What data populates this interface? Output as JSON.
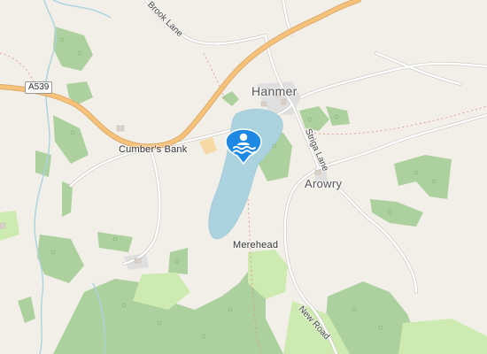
{
  "map": {
    "places": {
      "hanmer": "Hanmer",
      "arowry": "Arowry",
      "cumbers_bank": "Cumber's Bank",
      "merehead": "Merehead"
    },
    "roads": {
      "brook_lane": "Brook Lane",
      "striga_lane": "Striga Lane",
      "new_road": "New Road",
      "a539": "A539"
    },
    "marker": {
      "icon": "swimming-icon",
      "color": "#1e88e5"
    },
    "colors": {
      "land": "#f2efe9",
      "woodland": "#add19e",
      "grass": "#cdebb0",
      "water": "#aad3df",
      "major_road": "#f6c27a",
      "minor_road": "#ffffff"
    }
  }
}
